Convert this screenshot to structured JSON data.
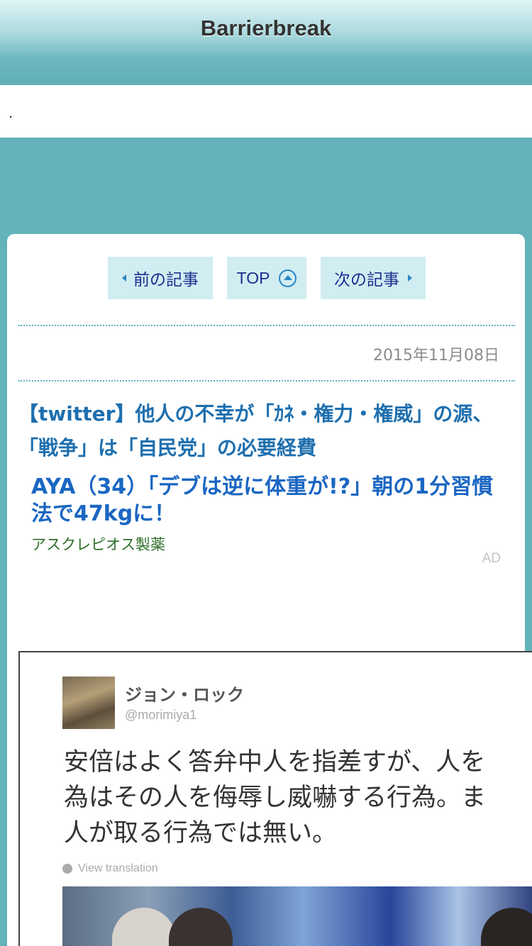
{
  "header": {
    "site_title": "Barrierbreak"
  },
  "notice": {
    "text": "."
  },
  "nav": {
    "prev_label": "前の記事",
    "top_label": "TOP",
    "next_label": "次の記事"
  },
  "post": {
    "date": "2015年11月08日",
    "title": "【twitter】他人の不幸が「ｶﾈ・権力・権威」の源、「戦争」は「自民党」の必要経費"
  },
  "ad": {
    "title": "AYA（34）「デブは逆に体重が!?」朝の1分習慣法で47kgに！",
    "sponsor": "アスクレピオス製薬",
    "label": "AD"
  },
  "tweet_image": {
    "name": "ジョン・ロック",
    "handle": "@morimiya1",
    "text": "安倍はよく答弁中人を指差すが、人を\n為はその人を侮辱し威嚇する行為。ま\n人が取る行為では無い。",
    "translate_label": "View translation"
  }
}
